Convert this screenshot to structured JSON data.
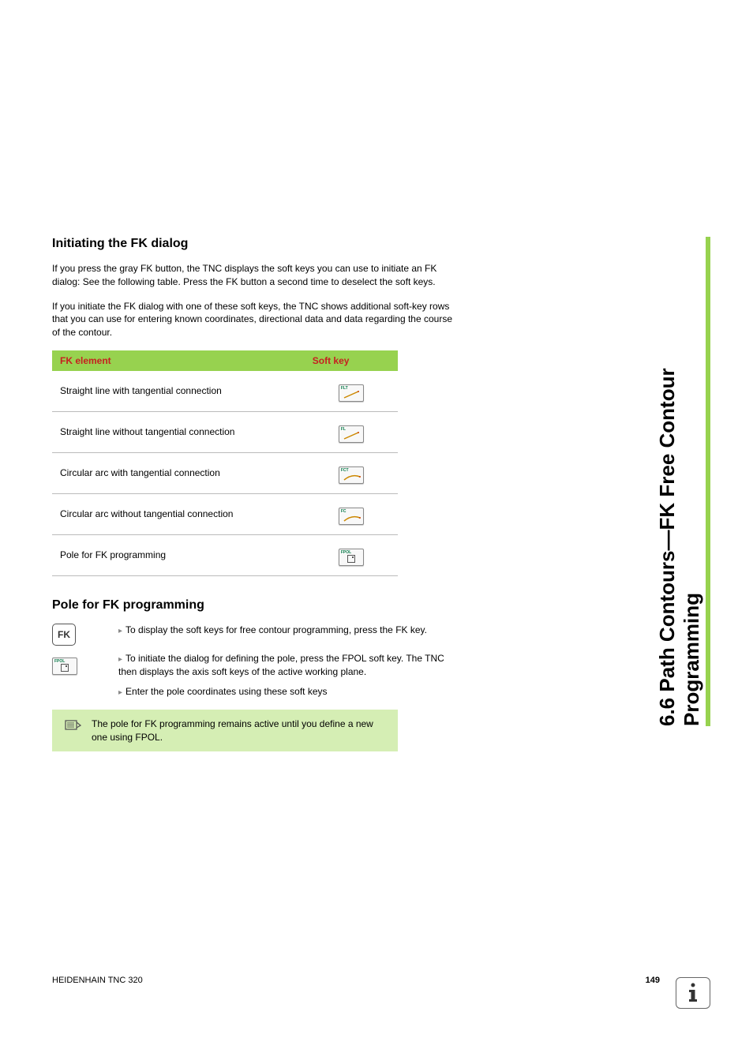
{
  "sidebar": {
    "title": "6.6 Path Contours—FK Free Contour Programming"
  },
  "section1": {
    "heading": "Initiating the FK dialog",
    "para1": "If you press the gray FK button, the TNC displays the soft keys you can use to initiate an FK dialog: See the following table. Press the FK button a second time to deselect the soft keys.",
    "para2": "If you initiate the FK dialog with one of these soft keys, the TNC shows additional soft-key rows that you can use for entering known coordinates, directional data and data regarding the course of the contour."
  },
  "table": {
    "header1": "FK element",
    "header2": "Soft key",
    "rows": [
      {
        "label": "Straight line with tangential connection",
        "key": "FLT"
      },
      {
        "label": "Straight line without tangential connection",
        "key": "FL"
      },
      {
        "label": "Circular arc with tangential connection",
        "key": "FCT"
      },
      {
        "label": "Circular arc without tangential connection",
        "key": "FC"
      },
      {
        "label": "Pole for FK programming",
        "key": "FPOL"
      }
    ]
  },
  "section2": {
    "heading": "Pole for FK programming",
    "fk_key_label": "FK",
    "fpol_key_label": "FPOL",
    "step1": "To display the soft keys for free contour programming, press the FK key.",
    "step2": "To initiate the dialog for defining the pole, press the FPOL soft key. The TNC then displays the axis soft keys of the active working plane.",
    "step3": "Enter the pole coordinates using these soft keys"
  },
  "note": {
    "text": "The pole for FK programming remains active until you define a new one using FPOL."
  },
  "footer": {
    "left": "HEIDENHAIN TNC 320",
    "page": "149"
  }
}
